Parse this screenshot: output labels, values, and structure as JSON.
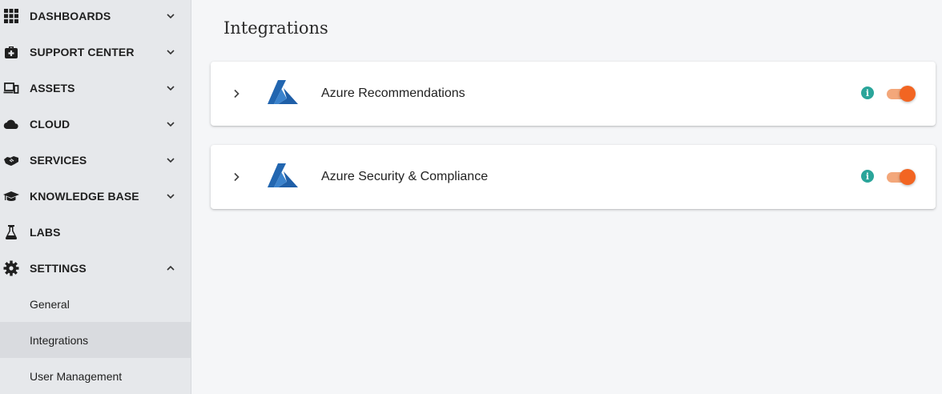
{
  "sidebar": {
    "items": [
      {
        "label": "DASHBOARDS",
        "icon": "grid-icon",
        "chevron": "down"
      },
      {
        "label": "SUPPORT CENTER",
        "icon": "medkit-icon",
        "chevron": "down"
      },
      {
        "label": "ASSETS",
        "icon": "devices-icon",
        "chevron": "down"
      },
      {
        "label": "CLOUD",
        "icon": "cloud-icon",
        "chevron": "down"
      },
      {
        "label": "SERVICES",
        "icon": "handshake-icon",
        "chevron": "down"
      },
      {
        "label": "KNOWLEDGE BASE",
        "icon": "graduation-cap-icon",
        "chevron": "down"
      },
      {
        "label": "LABS",
        "icon": "flask-icon",
        "chevron": ""
      },
      {
        "label": "SETTINGS",
        "icon": "gear-icon",
        "chevron": "up"
      }
    ],
    "settings_sub": [
      {
        "label": "General",
        "active": false
      },
      {
        "label": "Integrations",
        "active": true
      },
      {
        "label": "User Management",
        "active": false
      }
    ]
  },
  "main": {
    "title": "Integrations",
    "integrations": [
      {
        "name": "Azure Recommendations",
        "enabled": true,
        "logo": "azure-logo"
      },
      {
        "name": "Azure Security & Compliance",
        "enabled": true,
        "logo": "azure-logo"
      }
    ],
    "info_glyph": "i"
  },
  "colors": {
    "accent": "#f26522",
    "accent_track": "#f3a77a",
    "info": "#2aa59a",
    "azure": "#2266b0",
    "sidebar_bg": "#e6e8eb"
  }
}
